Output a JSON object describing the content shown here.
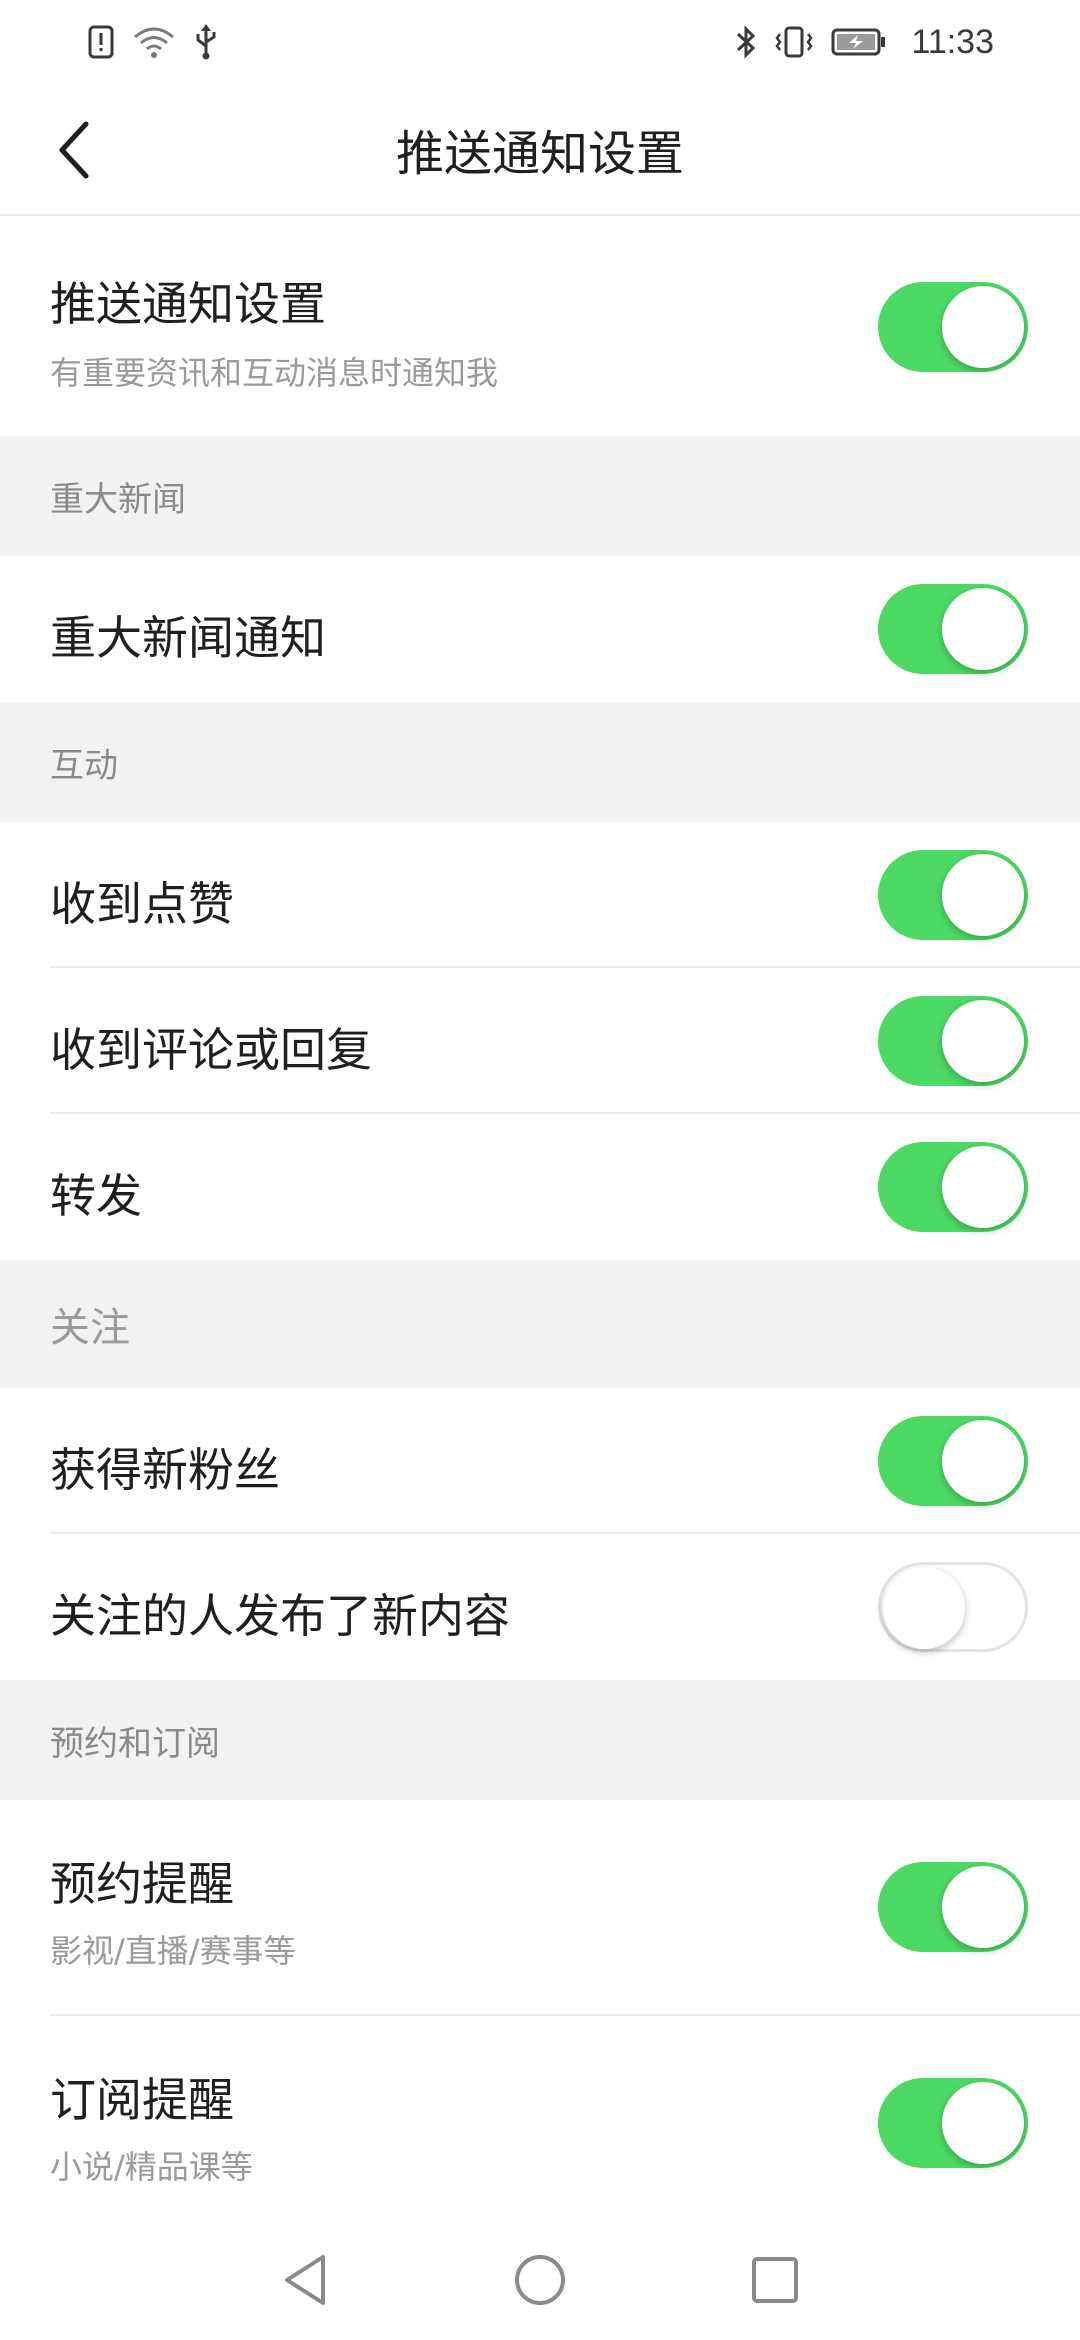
{
  "status_bar": {
    "time": "11:33",
    "left_icons": [
      "alert-icon",
      "wifi-icon",
      "usb-icon"
    ],
    "right_icons": [
      "bluetooth-icon",
      "vibrate-icon",
      "battery-icon"
    ]
  },
  "header": {
    "title": "推送通知设置",
    "back_icon": "chevron-left-icon"
  },
  "sections": [
    {
      "header": "",
      "rows": [
        {
          "title": "推送通知设置",
          "subtitle": "有重要资讯和互动消息时通知我",
          "enabled": true
        }
      ]
    },
    {
      "header": "重大新闻",
      "rows": [
        {
          "title": "重大新闻通知",
          "subtitle": "",
          "enabled": true
        }
      ]
    },
    {
      "header": "互动",
      "rows": [
        {
          "title": "收到点赞",
          "subtitle": "",
          "enabled": true
        },
        {
          "title": "收到评论或回复",
          "subtitle": "",
          "enabled": true
        },
        {
          "title": "转发",
          "subtitle": "",
          "enabled": true
        }
      ]
    },
    {
      "header": "关注",
      "rows": [
        {
          "title": "获得新粉丝",
          "subtitle": "",
          "enabled": true
        },
        {
          "title": "关注的人发布了新内容",
          "subtitle": "",
          "enabled": false
        }
      ]
    },
    {
      "header": "预约和订阅",
      "rows": [
        {
          "title": "预约提醒",
          "subtitle": "影视/直播/赛事等",
          "enabled": true
        },
        {
          "title": "订阅提醒",
          "subtitle": "小说/精品课等",
          "enabled": true
        }
      ]
    }
  ],
  "colors": {
    "toggle_on": "#4cd964",
    "section_bg": "#f2f2f2",
    "secondary_text": "#9a9a9a"
  },
  "nav_bar": {
    "buttons": [
      "back-triangle-icon",
      "home-circle-icon",
      "recents-square-icon"
    ]
  }
}
